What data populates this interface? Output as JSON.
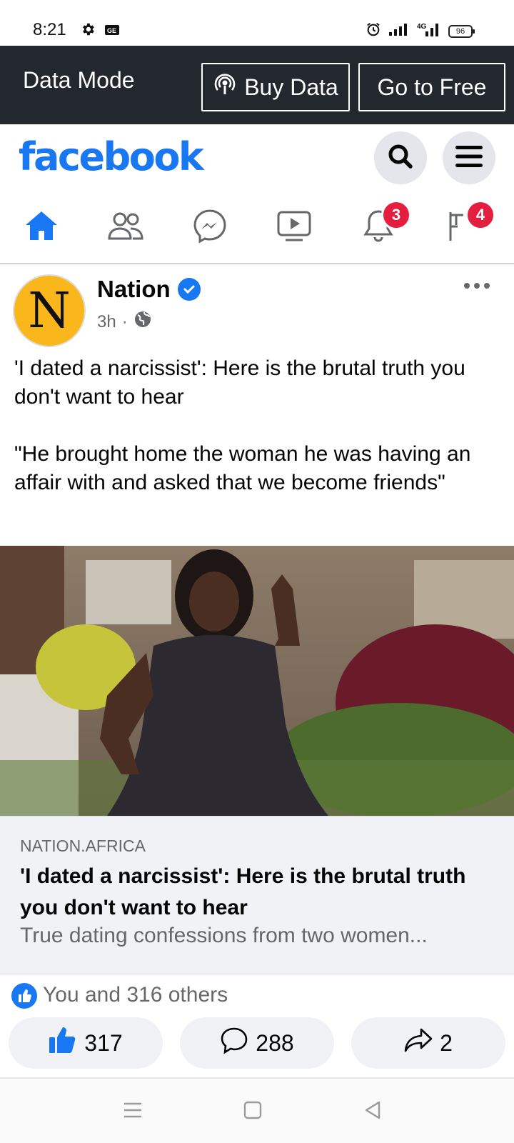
{
  "status_bar": {
    "time": "8:21",
    "network": "4G",
    "battery": "96"
  },
  "data_bar": {
    "mode_label": "Data Mode",
    "buy_label": "Buy Data",
    "free_label": "Go to Free"
  },
  "header": {
    "logo": "facebook"
  },
  "nav": {
    "notifications_badge": "3",
    "pages_badge": "4"
  },
  "post": {
    "author": "Nation",
    "avatar_letter": "N",
    "time": "3h",
    "separator": "·",
    "text_line1": "'I dated a narcissist': Here is the brutal truth you don't want to hear",
    "text_line2": "\"He brought home the woman he was having an affair with and asked that we become friends\"",
    "link": {
      "domain": "NATION.AFRICA",
      "title": "'I dated a narcissist': Here is the brutal truth you don't want to hear",
      "description": "True dating confessions from two women..."
    },
    "reactions_text": "You and 316 others",
    "like_count": "317",
    "comment_count": "288",
    "share_count": "2"
  },
  "colors": {
    "brand": "#1877f2",
    "badge": "#e41e3f",
    "data_bar": "#23272e",
    "avatar": "#f9b71c"
  },
  "icons": {
    "status": [
      "gear-icon",
      "sim-icon",
      "alarm-icon",
      "signal-icon",
      "battery-icon"
    ],
    "nav": [
      "home-icon",
      "friends-icon",
      "messenger-icon",
      "video-icon",
      "bell-icon",
      "pages-icon"
    ],
    "actions": [
      "like-icon",
      "comment-icon",
      "share-icon"
    ]
  }
}
